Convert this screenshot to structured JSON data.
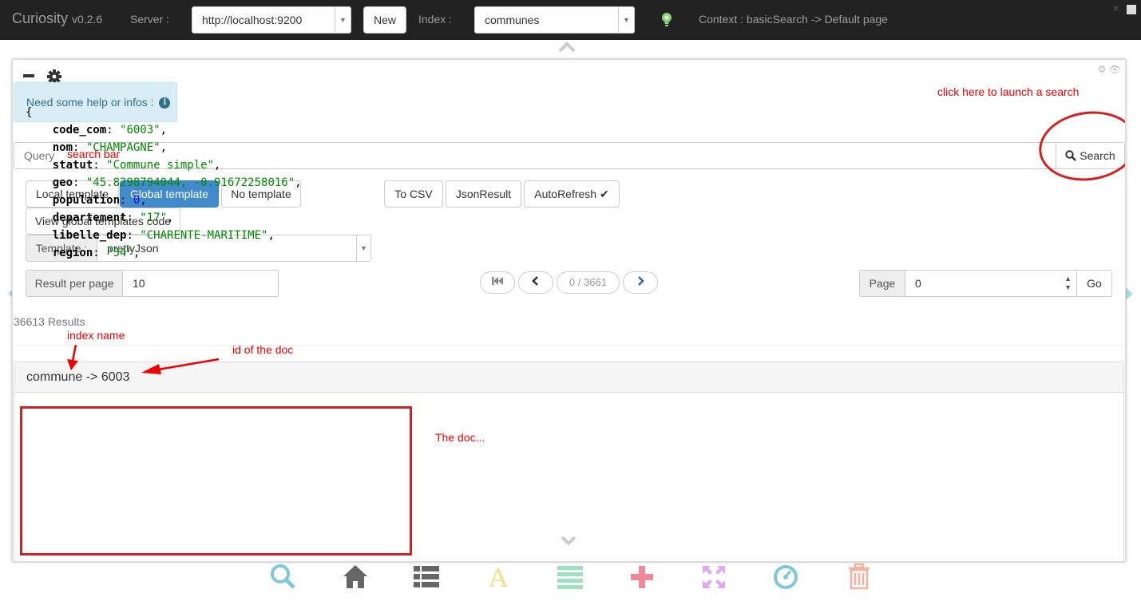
{
  "app": {
    "name": "Curiosity",
    "version": "v0.2.6"
  },
  "topbar": {
    "server_label": "Server :",
    "server_value": "http://localhost:9200",
    "new_button": "New",
    "index_label": "Index :",
    "index_value": "communes",
    "context": "Context : basicSearch -> Default page"
  },
  "help": {
    "text": "Need some help or infos :"
  },
  "annotations": {
    "launch": "click here to launch a search",
    "search_bar": "search bar",
    "index_name": "index name",
    "doc_id": "id of the doc",
    "doc": "The doc..."
  },
  "search": {
    "placeholder": "Query",
    "button": "Search"
  },
  "templates": {
    "local": "Local template",
    "global": "Global template",
    "none": "No template",
    "view_code": "View global templates code",
    "template_label": "Template :",
    "template_value": "prettyJson"
  },
  "exports": {
    "csv": "To CSV",
    "json": "JsonResult",
    "autorefresh": "AutoRefresh"
  },
  "paging": {
    "per_page_label": "Result per page",
    "per_page_value": "10",
    "position": "0 / 3661",
    "page_label": "Page",
    "page_value": "0",
    "go": "Go"
  },
  "results": {
    "count_text": "36613 Results"
  },
  "document": {
    "header": "commune -> 6003",
    "fields": [
      {
        "key": "code_com",
        "value": "\"6003\"",
        "type": "s"
      },
      {
        "key": "nom",
        "value": "\"CHAMPAGNE\"",
        "type": "s"
      },
      {
        "key": "statut",
        "value": "\"Commune simple\"",
        "type": "s"
      },
      {
        "key": "geo",
        "value": "\"45.8298794044, -0.91672258016\"",
        "type": "s"
      },
      {
        "key": "population",
        "value": "0",
        "type": "n"
      },
      {
        "key": "departement",
        "value": "\"17\"",
        "type": "s"
      },
      {
        "key": "libelle_dep",
        "value": "\"CHARENTE-MARITIME\"",
        "type": "s"
      },
      {
        "key": "region",
        "value": "\"54\"",
        "type": "s"
      }
    ]
  },
  "bottom_icons": [
    {
      "name": "search-icon",
      "color": "#7fc8dc"
    },
    {
      "name": "home-icon",
      "color": "#666666"
    },
    {
      "name": "list-icon",
      "color": "#666666"
    },
    {
      "name": "font-icon",
      "color": "#f5e08a"
    },
    {
      "name": "align-justify-icon",
      "color": "#9ee0c0"
    },
    {
      "name": "plus-icon",
      "color": "#f08898"
    },
    {
      "name": "fullscreen-icon",
      "color": "#e0a8f0"
    },
    {
      "name": "dashboard-icon",
      "color": "#80c8d8"
    },
    {
      "name": "trash-icon",
      "color": "#f5b0a0"
    }
  ]
}
